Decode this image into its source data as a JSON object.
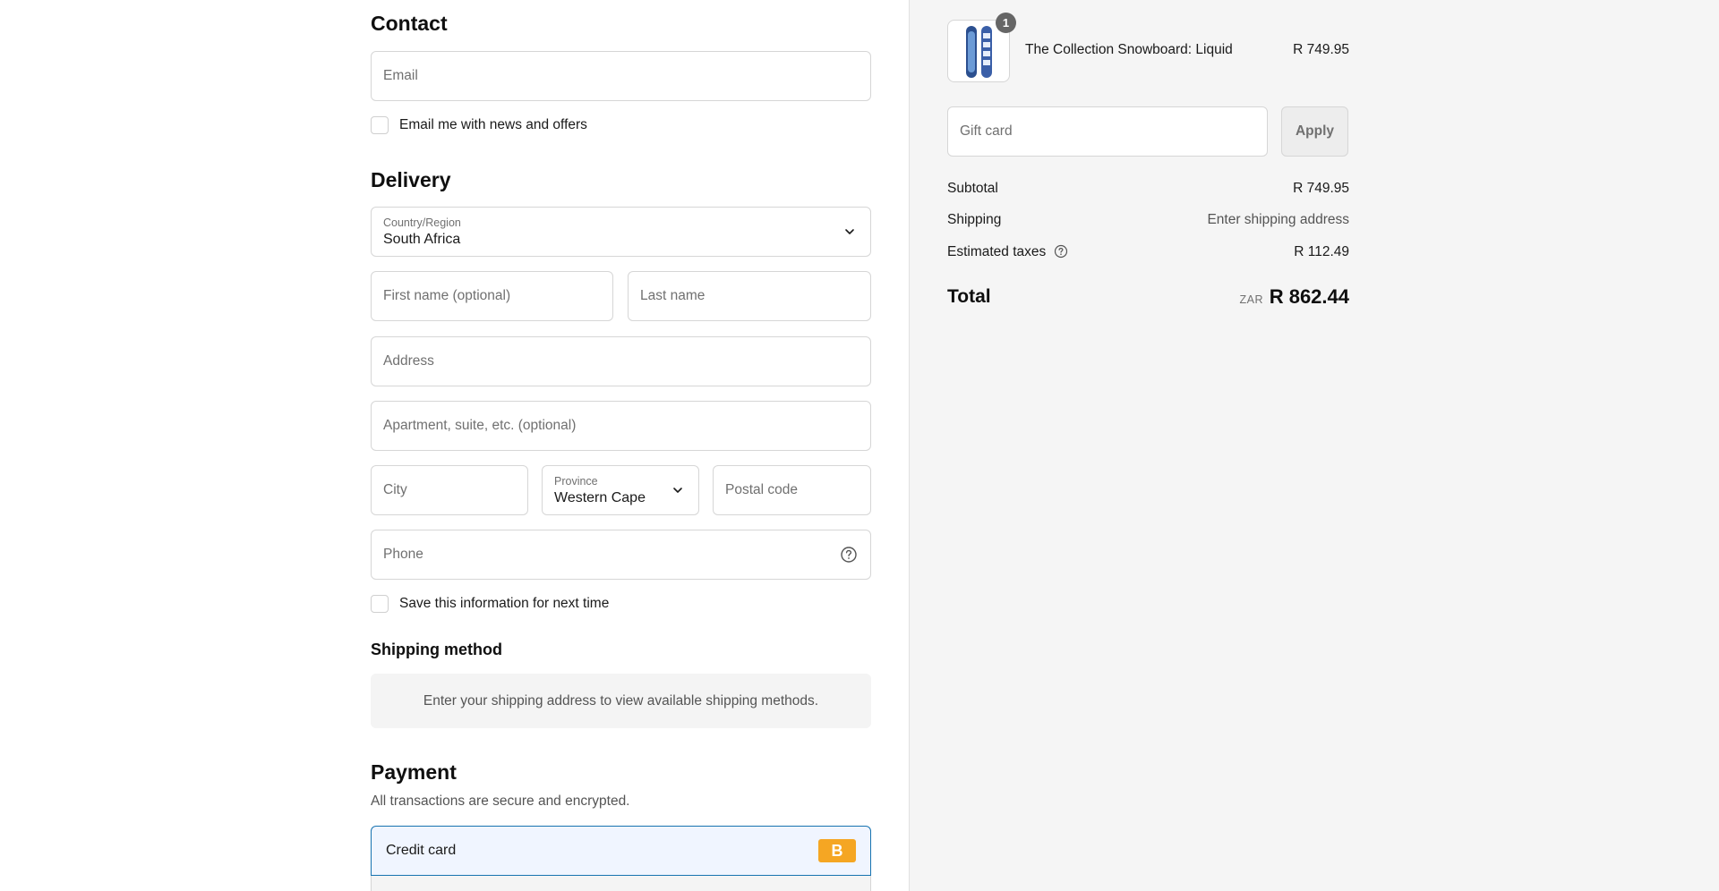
{
  "contact": {
    "heading": "Contact",
    "email_placeholder": "Email",
    "newsletter_label": "Email me with news and offers"
  },
  "delivery": {
    "heading": "Delivery",
    "country_label": "Country/Region",
    "country_value": "South Africa",
    "first_name_placeholder": "First name (optional)",
    "last_name_placeholder": "Last name",
    "address_placeholder": "Address",
    "apartment_placeholder": "Apartment, suite, etc. (optional)",
    "city_placeholder": "City",
    "province_label": "Province",
    "province_value": "Western Cape",
    "postal_placeholder": "Postal code",
    "phone_placeholder": "Phone",
    "save_info_label": "Save this information for next time"
  },
  "shipping_method": {
    "heading": "Shipping method",
    "message": "Enter your shipping address to view available shipping methods."
  },
  "payment": {
    "heading": "Payment",
    "subtitle": "All transactions are secure and encrypted.",
    "option_label": "Credit card",
    "badge": "B"
  },
  "cart": {
    "quantity": "1",
    "product_name": "The Collection Snowboard: Liquid",
    "product_price": "R 749.95"
  },
  "gift_card": {
    "placeholder": "Gift card",
    "apply_label": "Apply"
  },
  "summary": {
    "subtotal_label": "Subtotal",
    "subtotal_value": "R 749.95",
    "shipping_label": "Shipping",
    "shipping_value": "Enter shipping address",
    "taxes_label": "Estimated taxes",
    "taxes_value": "R 112.49",
    "total_label": "Total",
    "currency": "ZAR",
    "total_value": "R 862.44"
  },
  "colors": {
    "accent": "#1773b0",
    "badge": "#f5a623",
    "sidebar_bg": "#f5f5f5"
  }
}
